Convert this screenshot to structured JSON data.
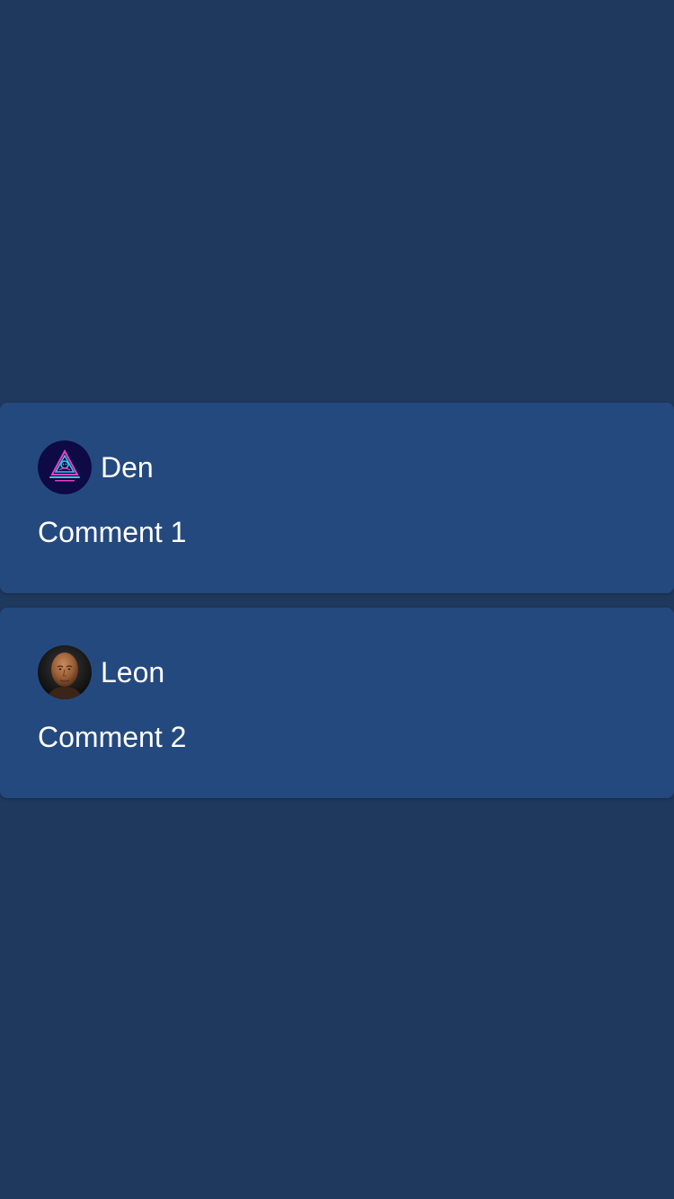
{
  "comments": [
    {
      "author": "Den",
      "avatar": "neon-triangle-logo-avatar",
      "text": "Comment 1"
    },
    {
      "author": "Leon",
      "avatar": "bald-man-portrait-avatar",
      "text": "Comment 2"
    }
  ],
  "colors": {
    "background": "#1f385d",
    "card": "#24497e",
    "text": "#ffffff",
    "neon_pink": "#e63fc6",
    "neon_cyan": "#39c6e6"
  }
}
